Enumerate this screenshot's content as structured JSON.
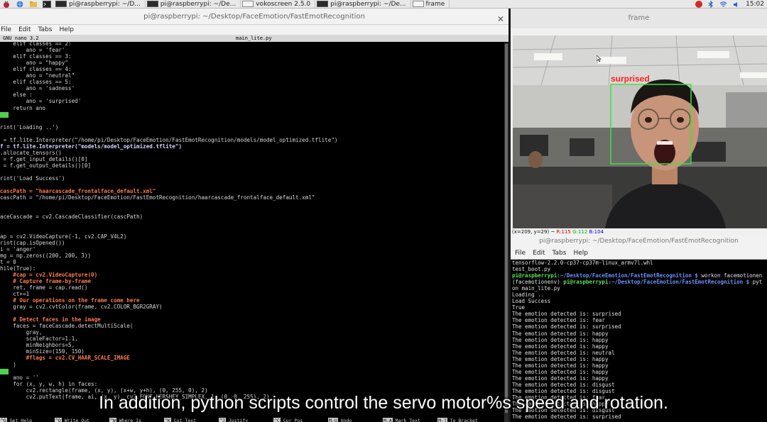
{
  "taskbar": {
    "tasks": [
      {
        "label": "pi@raspberrypi: ~/D..."
      },
      {
        "label": "pi@raspberrypi: ~/De..."
      },
      {
        "label": "vokoscreen 2.5.0"
      },
      {
        "label": "pi@raspberrypi: ~/De..."
      },
      {
        "label": "frame"
      }
    ],
    "clock": "15:02"
  },
  "editor": {
    "title": "pi@raspberrypi: ~/Desktop/FaceEmotion/FastEmotRecognition",
    "menu": [
      "File",
      "Edit",
      "Tabs",
      "Help"
    ],
    "nano_version": "GNU nano 3.2",
    "filename": "main_lite.py",
    "lines": [
      {
        "t": "    elif classes == 2:"
      },
      {
        "t": "        ano = 'fear'"
      },
      {
        "t": "    elif classes == 3:"
      },
      {
        "t": "        ano = \"happy\""
      },
      {
        "t": "    elif classes == 4:"
      },
      {
        "t": "        ano = \"neutral\""
      },
      {
        "t": "    elif classes == 5:"
      },
      {
        "t": "        ano = 'sadness'"
      },
      {
        "t": "    else :"
      },
      {
        "t": "        ano = 'surprised'"
      },
      {
        "t": "    return ano"
      },
      {
        "t": "",
        "cursor": true
      },
      {
        "t": ""
      },
      {
        "t": "rint('Loading ..')"
      },
      {
        "t": ""
      },
      {
        "t": " = tf.lite.Interpreter(\"/home/pi/Desktop/FaceEmotion/FastEmotRecognition/models/model_optimized.tflite\")"
      },
      {
        "t": "f = tf.lite.Interpreter(\"models/model_optimized.tflite\")",
        "cls": "kw"
      },
      {
        "t": ".allocate_tensors()"
      },
      {
        "t": " = f.get_input_details()[0]"
      },
      {
        "t": " = f.get_output_details()[0]"
      },
      {
        "t": ""
      },
      {
        "t": "rint('Load Success')"
      },
      {
        "t": ""
      },
      {
        "t": "cascPath = \"haarcascade_frontalface_default.xml\"",
        "cls": "cm"
      },
      {
        "t": "cascPath = \"/home/pi/Desktop/FaceEmotion/FastEmotRecognition/haarcascade_frontalface_default.xml\""
      },
      {
        "t": ""
      },
      {
        "t": ""
      },
      {
        "t": "aceCascade = cv2.CascadeClassifier(cascPath)"
      },
      {
        "t": ""
      },
      {
        "t": ""
      },
      {
        "t": "ap = cv2.VideoCapture(-1, cv2.CAP_V4L2)"
      },
      {
        "t": "rint(cap.isOpened())"
      },
      {
        "t": "i = 'anger'"
      },
      {
        "t": "mg = np.zeros((200, 200, 3))"
      },
      {
        "t": "t = 0"
      },
      {
        "t": "hile(True):"
      },
      {
        "t": "    #cap = cv2.VideoCapture(0)",
        "cls": "cm"
      },
      {
        "t": "    # Capture frame-by-frame",
        "cls": "cm"
      },
      {
        "t": "    ret, frame = cap.read()"
      },
      {
        "t": "    ct+=1"
      },
      {
        "t": "    # Our operations on the frame come here",
        "cls": "cm"
      },
      {
        "t": "    gray = cv2.cvtColor(frame, cv2.COLOR_BGR2GRAY)"
      },
      {
        "t": ""
      },
      {
        "t": "    # Detect faces in the image",
        "cls": "cm"
      },
      {
        "t": "    faces = faceCascade.detectMultiScale("
      },
      {
        "t": "        gray,"
      },
      {
        "t": "        scaleFactor=1.1,"
      },
      {
        "t": "        minNeighbors=5,"
      },
      {
        "t": "        minSize=(150, 150)"
      },
      {
        "t": "        #flags = cv2.CV_HAAR_SCALE_IMAGE",
        "cls": "cm"
      },
      {
        "t": "    )"
      },
      {
        "t": "",
        "cursor": true
      },
      {
        "t": "    ano = ''"
      },
      {
        "t": "    for (x, y, w, h) in faces:"
      },
      {
        "t": "        cv2.rectangle(frame, (x, y), (x+w, y+h), (0, 255, 0), 2)"
      },
      {
        "t": "        cv2.putText(frame, ai, (x, y), cv2.FONT_HERSHEY_SIMPLEX, 1, (0, 0, 255), 2)"
      }
    ],
    "shortcuts": [
      {
        "key": "^G",
        "label": "Get Help"
      },
      {
        "key": "^O",
        "label": "Write Out"
      },
      {
        "key": "^W",
        "label": "Where Is"
      },
      {
        "key": "^K",
        "label": "Cut Text"
      },
      {
        "key": "^J",
        "label": "Justify"
      },
      {
        "key": "^C",
        "label": "Cur Pos"
      },
      {
        "key": "M-U",
        "label": "Undo"
      },
      {
        "key": "M-A",
        "label": "Mark Text"
      },
      {
        "key": "M-]",
        "label": "To Bracket"
      }
    ]
  },
  "frame_window": {
    "title": "frame",
    "emotion_label": "surprised",
    "status": {
      "coords": "(x=209, y=29) ~ ",
      "r": "R:115",
      "g": "G:112",
      "b": "B:104"
    }
  },
  "terminal": {
    "title": "pi@raspberrypi: ~/Desktop/FaceEmotion/FastEmotRecognition",
    "menu": [
      "File",
      "Edit",
      "Tabs",
      "Help"
    ],
    "lines": [
      {
        "t": "tensorflow-2.2.0-cp37-cp37m-linux_armv7l.whl"
      },
      {
        "t": "test_boot.py"
      },
      {
        "p1": "pi@raspberrypi",
        "p2": ":~/Desktop/FaceEmotion/FastEmotRecognition $",
        "t": " workon facemotionen"
      },
      {
        "t": "(facemotionenv) ",
        "p1": "pi@raspberrypi",
        "p2": ":~/Desktop/FaceEmotion/FastEmotRecognition $",
        "t2": " pyt"
      },
      {
        "t": "on main_lite.py"
      },
      {
        "t": "Loading .."
      },
      {
        "t": "Load Success"
      },
      {
        "t": "True"
      },
      {
        "t": "The emotion detected is: surprised"
      },
      {
        "t": "The emotion detected is: fear"
      },
      {
        "t": "The emotion detected is: surprised"
      },
      {
        "t": "The emotion detected is: happy"
      },
      {
        "t": "The emotion detected is: happy"
      },
      {
        "t": "The emotion detected is: happy"
      },
      {
        "t": "The emotion detected is: neutral"
      },
      {
        "t": "The emotion detected is: happy"
      },
      {
        "t": "The emotion detected is: happy"
      },
      {
        "t": "The emotion detected is: happy"
      },
      {
        "t": "The emotion detected is: happy"
      },
      {
        "t": "The emotion detected is: disgust"
      },
      {
        "t": "The emotion detected is: disgust"
      },
      {
        "t": "The emotion detected is: fear"
      },
      {
        "t": "The emotion detected is: happy"
      },
      {
        "t": "The emotion detected is: disgust"
      },
      {
        "t": "The emotion detected is: surprised"
      }
    ]
  },
  "subtitle": "In addition, python scripts control the servo motor%s speed and rotation.",
  "colors": {
    "nano_comment": "#ff7a4a",
    "nano_string": "#f4f46a",
    "prompt_green": "#59e05a",
    "prompt_blue": "#6f8ff8",
    "face_box": "#3ee03e",
    "label_red": "#ff2020"
  }
}
